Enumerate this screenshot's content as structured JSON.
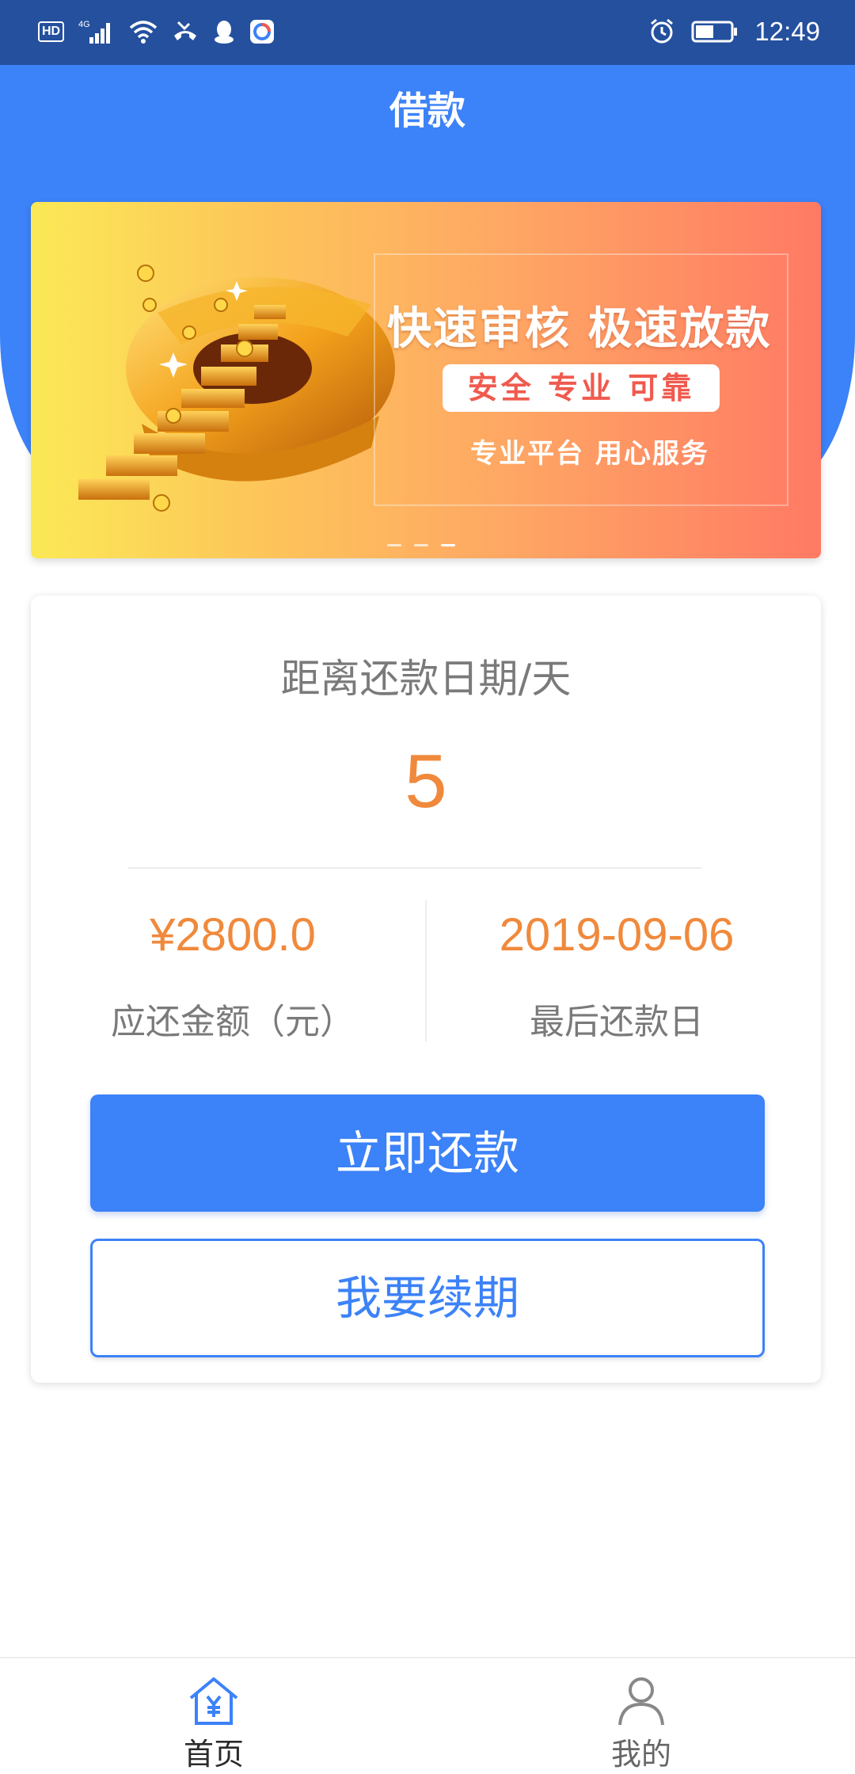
{
  "status_bar": {
    "hd": "HD",
    "network": "4G",
    "time": "12:49"
  },
  "header": {
    "title": "借款"
  },
  "banner": {
    "headline": "快速审核 极速放款",
    "pill": "安全 专业 可靠",
    "subline": "专业平台 用心服务",
    "active_slide": 3,
    "slide_count": 3
  },
  "repayment_card": {
    "days_label": "距离还款日期/天",
    "days_value": "5",
    "amount_value": "¥2800.0",
    "amount_caption": "应还金额（元）",
    "due_date_value": "2019-09-06",
    "due_date_caption": "最后还款日",
    "repay_button": "立即还款",
    "renew_button": "我要续期"
  },
  "bottom_nav": {
    "items": [
      {
        "label": "首页",
        "icon": "home-yen-icon",
        "active": true
      },
      {
        "label": "我的",
        "icon": "user-icon",
        "active": false
      }
    ]
  },
  "colors": {
    "status_bar": "#24509e",
    "primary": "#3c82f8",
    "accent_orange": "#f0893c",
    "muted_text": "#7a7a7a"
  }
}
